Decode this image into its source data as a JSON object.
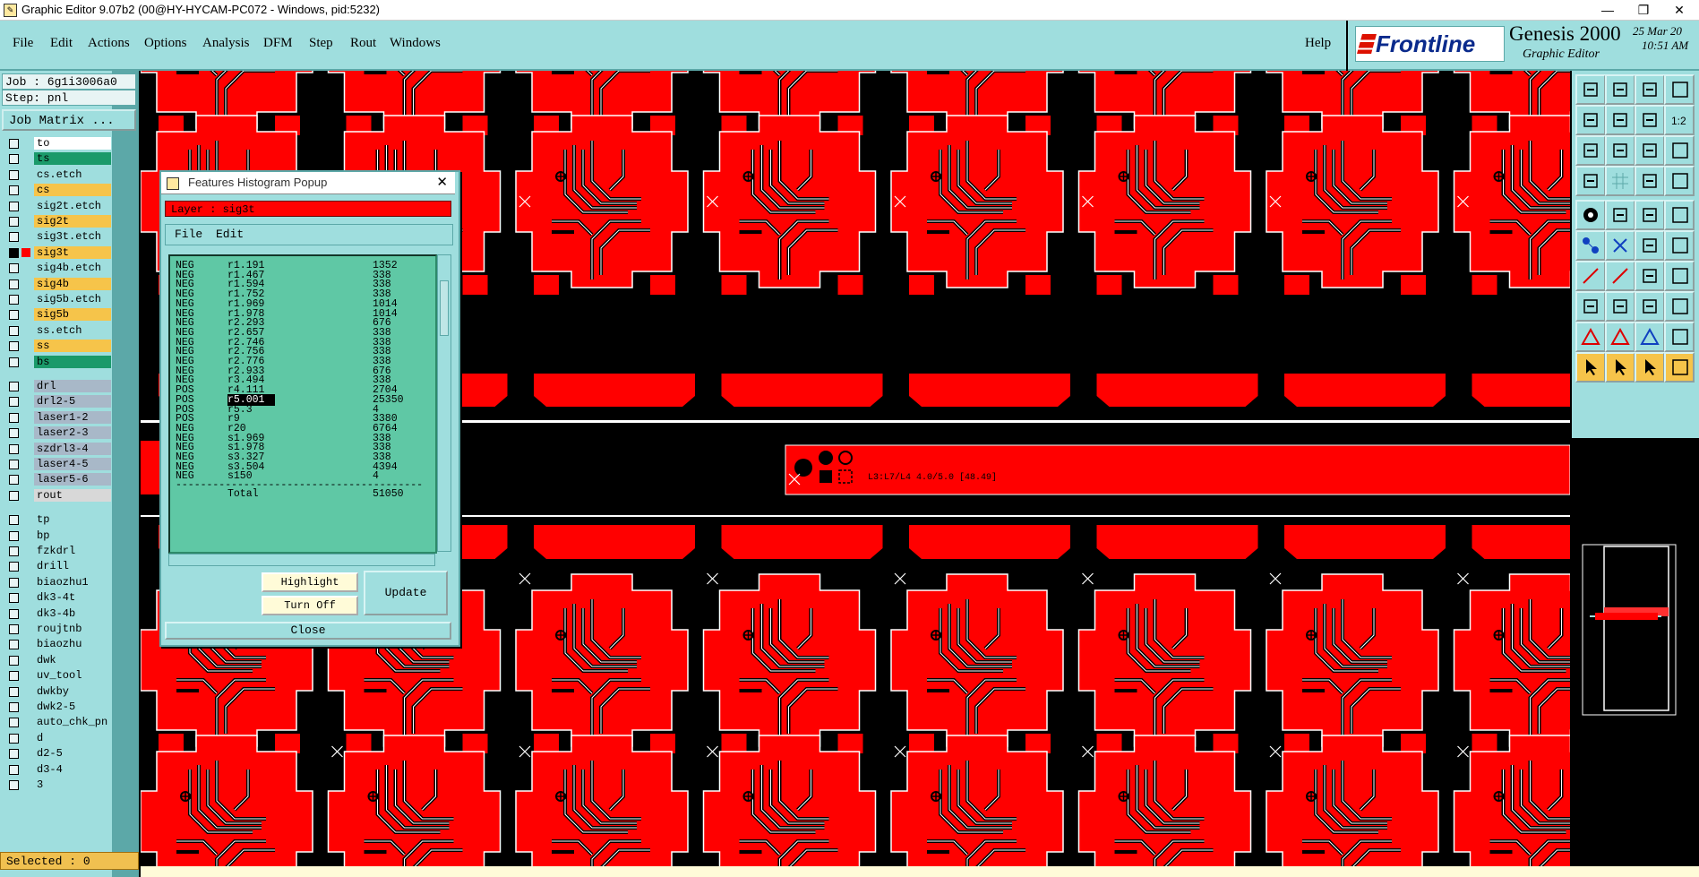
{
  "window": {
    "title": "Graphic Editor 9.07b2 (00@HY-HYCAM-PC072 - Windows, pid:5232)",
    "minimize": "—",
    "restore": "❐",
    "close": "✕"
  },
  "menu": [
    "File",
    "Edit",
    "Actions",
    "Options",
    "Analysis",
    "DFM",
    "Step",
    "Rout",
    "Windows"
  ],
  "help_label": "Help",
  "brand": {
    "logo_text": "Frontline",
    "product": "Genesis 2000",
    "subtitle": "Graphic Editor",
    "date": "25 Mar 20",
    "time": "10:51 AM"
  },
  "job": {
    "job_line": "Job : 6g1i3006a0",
    "step_line": "Step: pnl",
    "matrix_button": "Job Matrix ..."
  },
  "layers": [
    {
      "name": "to",
      "color": "#ffffff"
    },
    {
      "name": "ts",
      "color": "#1a9a6a"
    },
    {
      "name": "cs.etch",
      "color": "#9fdede"
    },
    {
      "name": "cs",
      "color": "#f6c44a"
    },
    {
      "name": "sig2t.etch",
      "color": "#9fdede"
    },
    {
      "name": "sig2t",
      "color": "#f6c44a"
    },
    {
      "name": "sig3t.etch",
      "color": "#9fdede"
    },
    {
      "name": "sig3t",
      "color": "#f6c44a",
      "active": true
    },
    {
      "name": "sig4b.etch",
      "color": "#9fdede"
    },
    {
      "name": "sig4b",
      "color": "#f6c44a"
    },
    {
      "name": "sig5b.etch",
      "color": "#9fdede"
    },
    {
      "name": "sig5b",
      "color": "#f6c44a"
    },
    {
      "name": "ss.etch",
      "color": "#9fdede"
    },
    {
      "name": "ss",
      "color": "#f6c44a"
    },
    {
      "name": "bs",
      "color": "#1a9a6a"
    },
    {
      "name": "drl",
      "color": "#a8b8c8"
    },
    {
      "name": "drl2-5",
      "color": "#a8b8c8"
    },
    {
      "name": "laser1-2",
      "color": "#a8b8c8"
    },
    {
      "name": "laser2-3",
      "color": "#a8b8c8"
    },
    {
      "name": "szdrl3-4",
      "color": "#a8b8c8"
    },
    {
      "name": "laser4-5",
      "color": "#a8b8c8"
    },
    {
      "name": "laser5-6",
      "color": "#a8b8c8"
    },
    {
      "name": "rout",
      "color": "#d8d8d8"
    },
    {
      "name": "tp",
      "color": "#9fdede"
    },
    {
      "name": "bp",
      "color": "#9fdede"
    },
    {
      "name": "fzkdrl",
      "color": "#9fdede"
    },
    {
      "name": "drill",
      "color": "#9fdede"
    },
    {
      "name": "biaozhu1",
      "color": "#9fdede"
    },
    {
      "name": "dk3-4t",
      "color": "#9fdede"
    },
    {
      "name": "dk3-4b",
      "color": "#9fdede"
    },
    {
      "name": "roujtnb",
      "color": "#9fdede"
    },
    {
      "name": "biaozhu",
      "color": "#9fdede"
    },
    {
      "name": "dwk",
      "color": "#9fdede"
    },
    {
      "name": "uv_tool",
      "color": "#9fdede"
    },
    {
      "name": "dwkby",
      "color": "#9fdede"
    },
    {
      "name": "dwk2-5",
      "color": "#9fdede"
    },
    {
      "name": "auto_chk_pn",
      "color": "#9fdede"
    },
    {
      "name": "d",
      "color": "#9fdede"
    },
    {
      "name": "d2-5",
      "color": "#9fdede"
    },
    {
      "name": "d3-4",
      "color": "#9fdede"
    },
    {
      "name": "3",
      "color": "#9fdede"
    }
  ],
  "selected_text": "Selected : 0",
  "popup": {
    "title": "Features Histogram Popup",
    "close_x": "✕",
    "layer_label": "Layer :  sig3t",
    "menu_file": "File",
    "menu_edit": "Edit",
    "rows": [
      {
        "pol": "NEG",
        "sym": "r1.191",
        "count": "1352"
      },
      {
        "pol": "NEG",
        "sym": "r1.467",
        "count": "338"
      },
      {
        "pol": "NEG",
        "sym": "r1.594",
        "count": "338"
      },
      {
        "pol": "NEG",
        "sym": "r1.752",
        "count": "338"
      },
      {
        "pol": "NEG",
        "sym": "r1.969",
        "count": "1014"
      },
      {
        "pol": "NEG",
        "sym": "r1.978",
        "count": "1014"
      },
      {
        "pol": "NEG",
        "sym": "r2.293",
        "count": "676"
      },
      {
        "pol": "NEG",
        "sym": "r2.657",
        "count": "338"
      },
      {
        "pol": "NEG",
        "sym": "r2.746",
        "count": "338"
      },
      {
        "pol": "NEG",
        "sym": "r2.756",
        "count": "338"
      },
      {
        "pol": "NEG",
        "sym": "r2.776",
        "count": "338"
      },
      {
        "pol": "NEG",
        "sym": "r2.933",
        "count": "676"
      },
      {
        "pol": "NEG",
        "sym": "r3.494",
        "count": "338"
      },
      {
        "pol": "POS",
        "sym": "r4.111",
        "count": "2704"
      },
      {
        "pol": "POS",
        "sym": "r5.001",
        "count": "25350",
        "selected": true
      },
      {
        "pol": "POS",
        "sym": "r5.3",
        "count": "4"
      },
      {
        "pol": "POS",
        "sym": "r9",
        "count": "3380"
      },
      {
        "pol": "NEG",
        "sym": "r20",
        "count": "6764"
      },
      {
        "pol": "NEG",
        "sym": "s1.969",
        "count": "338"
      },
      {
        "pol": "NEG",
        "sym": "s1.978",
        "count": "338"
      },
      {
        "pol": "NEG",
        "sym": "s3.327",
        "count": "338"
      },
      {
        "pol": "NEG",
        "sym": "s3.504",
        "count": "4394"
      },
      {
        "pol": "NEG",
        "sym": "s150",
        "count": "4"
      }
    ],
    "separator": "----------------------------------------",
    "total_label": "Total",
    "total_value": "51050",
    "highlight_label": "Highlight",
    "turnoff_label": "Turn Off",
    "update_label": "Update",
    "close_label": "Close"
  },
  "canvas_text": {
    "strip_label": "L3:L7/L4 4.0/5.0 [48.49]"
  },
  "toolbar_zoom_label": "1:2",
  "colors": {
    "panel": "#9fdede",
    "copper": "#ff0000",
    "background": "#000000",
    "highlight_row": "#f6c44a"
  }
}
